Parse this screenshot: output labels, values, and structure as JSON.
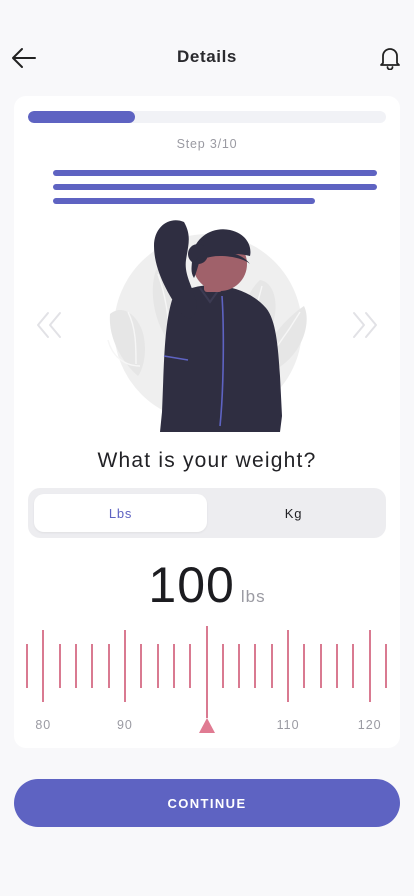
{
  "header": {
    "title": "Details",
    "back_icon": "arrow-left-icon",
    "bell_icon": "bell-icon"
  },
  "progress": {
    "fraction": 0.3,
    "step_label": "Step 3/10"
  },
  "description": {
    "line_fractions": [
      1.0,
      1.0,
      0.81
    ]
  },
  "carousel": {
    "prev_icon": "double-chevron-left-icon",
    "next_icon": "double-chevron-right-icon"
  },
  "question": "What is your weight?",
  "unit_toggle": {
    "options": [
      "Lbs",
      "Kg"
    ],
    "selected": "Lbs"
  },
  "weight": {
    "value": "100",
    "unit": "lbs"
  },
  "ruler": {
    "min": 78,
    "max": 122,
    "selected_value": 100,
    "major_every": 10,
    "labels": [
      "80",
      "90",
      "110",
      "120"
    ]
  },
  "continue_label": "CONTINUE",
  "colors": {
    "accent": "#5e63c2",
    "ruler_tick": "#d97a91",
    "background": "#f8f8fa",
    "card": "#ffffff"
  }
}
